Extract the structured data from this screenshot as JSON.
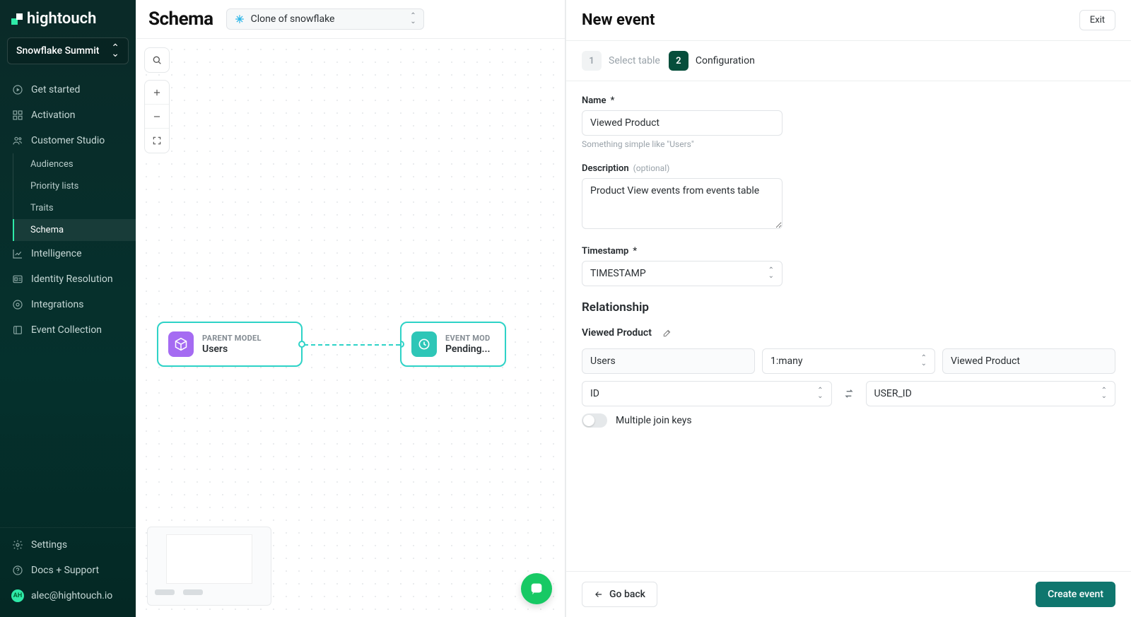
{
  "brand": "hightouch",
  "workspace": "Snowflake Summit",
  "nav": {
    "get_started": "Get started",
    "activation": "Activation",
    "customer_studio": "Customer Studio",
    "customer_studio_items": {
      "audiences": "Audiences",
      "priority_lists": "Priority lists",
      "traits": "Traits",
      "schema": "Schema"
    },
    "intelligence": "Intelligence",
    "identity_resolution": "Identity Resolution",
    "integrations": "Integrations",
    "event_collection": "Event Collection"
  },
  "footer": {
    "settings": "Settings",
    "docs": "Docs + Support",
    "user_email": "alec@hightouch.io",
    "user_initials": "AH"
  },
  "canvas": {
    "title": "Schema",
    "source": "Clone of snowflake",
    "nodes": {
      "parent": {
        "type": "PARENT MODEL",
        "name": "Users"
      },
      "event": {
        "type": "EVENT MOD",
        "name": "Pending..."
      }
    }
  },
  "panel": {
    "title": "New event",
    "exit": "Exit",
    "steps": {
      "one_num": "1",
      "one_label": "Select table",
      "two_num": "2",
      "two_label": "Configuration"
    },
    "form": {
      "name_label": "Name",
      "name_value": "Viewed Product",
      "name_hint": "Something simple like \"Users\"",
      "desc_label": "Description",
      "desc_value": "Product View events from events table",
      "timestamp_label": "Timestamp",
      "timestamp_value": "TIMESTAMP",
      "relationship_title": "Relationship",
      "relationship_name": "Viewed Product",
      "left_model": "Users",
      "cardinality": "1:many",
      "right_model": "Viewed Product",
      "left_key": "ID",
      "right_key": "USER_ID",
      "multi_join_label": "Multiple join keys"
    },
    "footer": {
      "back": "Go back",
      "create": "Create event"
    }
  },
  "misc": {
    "star": "*",
    "optional": "(optional)"
  }
}
